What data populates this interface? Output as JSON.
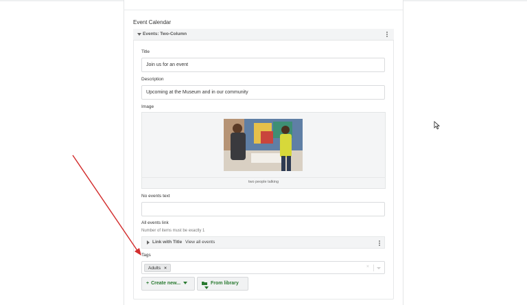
{
  "section": {
    "title": "Event Calendar"
  },
  "paragraph": {
    "type_label": "Events: Two-Column"
  },
  "fields": {
    "title": {
      "label": "Title",
      "value": "Join us for an event"
    },
    "description": {
      "label": "Description",
      "value": "Upcoming at the Museum and in our community"
    },
    "image": {
      "label": "Image",
      "caption": "two people talking"
    },
    "no_events": {
      "label": "No events text",
      "value": ""
    },
    "all_events_link": {
      "label": "All events link",
      "hint": "Number of items must be exactly 1",
      "item_type": "Link with Title",
      "item_value": "View all events"
    },
    "tags": {
      "label": "Tags",
      "chips": [
        "Adults"
      ],
      "remove_glyph": "×",
      "clear_glyph": "×"
    }
  },
  "buttons": {
    "create_new": {
      "label": "Create new...",
      "icon": "plus-icon"
    },
    "from_library": {
      "label": "From library",
      "icon": "folder-icon"
    }
  },
  "colors": {
    "accent_green": "#2a7a31",
    "annotation_arrow": "#d32f2f"
  }
}
